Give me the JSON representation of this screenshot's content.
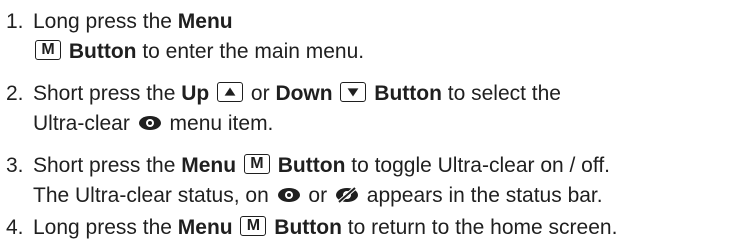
{
  "steps": [
    {
      "number": "1.",
      "lines": [
        [
          "Long press the ",
          "Menu"
        ],
        [
          "Button",
          " to enter the main menu."
        ]
      ]
    },
    {
      "number": "2.",
      "lines": [
        [
          "Short press the ",
          "Up",
          " or ",
          "Down",
          "Button",
          " to select the"
        ],
        [
          "Ultra-clear ",
          " menu item."
        ]
      ]
    },
    {
      "number": "3.",
      "lines": [
        [
          "Short press the ",
          "Menu",
          "Button",
          " to toggle Ultra-clear on / off."
        ],
        [
          "The Ultra-clear status, on ",
          " or ",
          " appears in the status bar."
        ]
      ]
    },
    {
      "number": "4.",
      "lines": [
        [
          "Long press the ",
          "Menu",
          "Button",
          " to return to the home screen."
        ]
      ]
    }
  ],
  "keys": {
    "menu": "M"
  },
  "icons": {
    "up_button": "triangle-up-icon",
    "down_button": "triangle-down-icon",
    "ultra_clear": "eye-icon",
    "ultra_clear_off": "eye-slash-icon"
  },
  "colors": {
    "text": "#1f1f1f",
    "background": "#ffffff"
  }
}
